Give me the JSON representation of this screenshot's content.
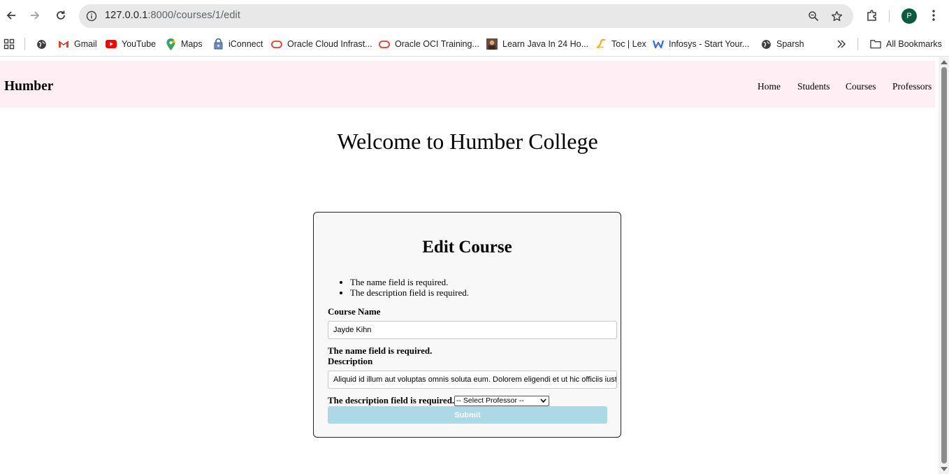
{
  "browser": {
    "url_host": "127.0.0.1",
    "url_path": ":8000/courses/1/edit",
    "profile_initial": "P",
    "bookmarks": [
      {
        "label": "Gmail",
        "icon": "gmail-icon"
      },
      {
        "label": "YouTube",
        "icon": "youtube-icon"
      },
      {
        "label": "Maps",
        "icon": "maps-icon"
      },
      {
        "label": "iConnect",
        "icon": "iconnect-icon"
      },
      {
        "label": "Oracle Cloud Infrast...",
        "icon": "oracle-icon"
      },
      {
        "label": "Oracle OCI Training...",
        "icon": "oracle-icon"
      },
      {
        "label": "Learn Java In 24 Ho...",
        "icon": "java-thumbnail-icon"
      },
      {
        "label": "Toc | Lex",
        "icon": "lex-icon"
      },
      {
        "label": "Infosys - Start Your...",
        "icon": "infosys-icon"
      },
      {
        "label": "Sparsh",
        "icon": "globe-icon"
      }
    ],
    "all_bookmarks_label": "All Bookmarks"
  },
  "site": {
    "brand": "Humber",
    "nav": [
      "Home",
      "Students",
      "Courses",
      "Professors"
    ],
    "header_color": "#ffeef3"
  },
  "main": {
    "welcome": "Welcome to Humber College",
    "form": {
      "title": "Edit Course",
      "errors": [
        "The name field is required.",
        "The description field is required."
      ],
      "name_label": "Course Name",
      "name_value": "Jayde Kihn",
      "name_error": "The name field is required.",
      "description_label": "Description",
      "description_value": "Aliquid id illum aut voluptas omnis soluta eum. Dolorem eligendi et ut hic officiis iusto",
      "description_error": "The description field is required.",
      "professor_select": "-- Select Professor --",
      "submit_label": "Submit",
      "submit_color": "#add8e6"
    }
  }
}
